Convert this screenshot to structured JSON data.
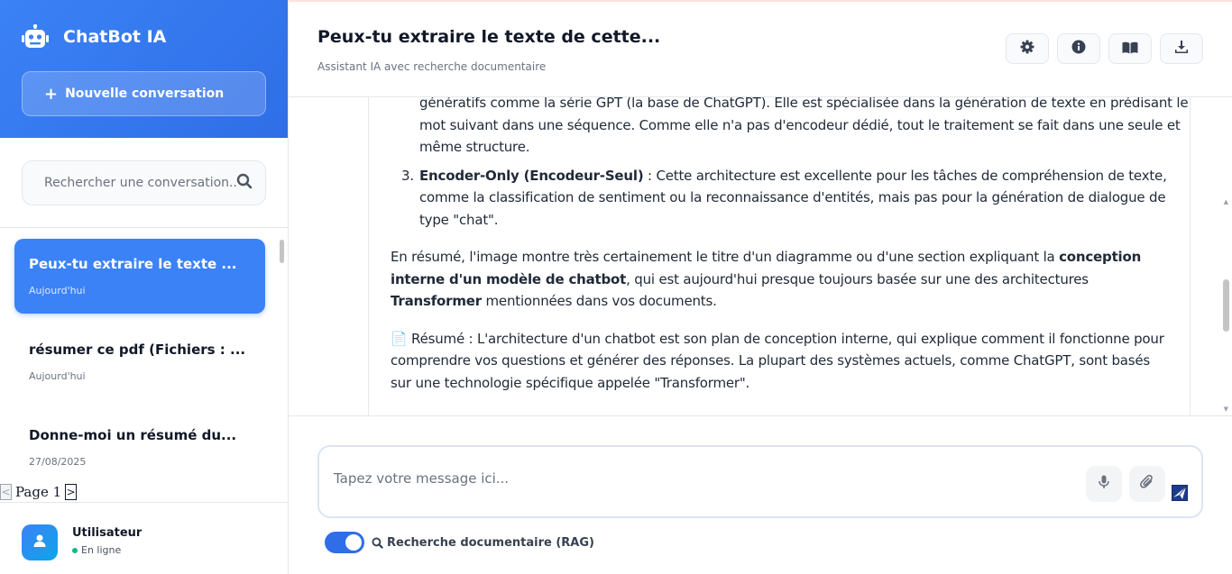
{
  "app": {
    "title": "ChatBot IA",
    "icons": {
      "brand": "robot-icon"
    },
    "colors": {
      "accent": "#3b82f6",
      "online": "#10b981"
    }
  },
  "sidebar": {
    "new_conversation_label": "Nouvelle conversation",
    "search_placeholder": "Rechercher une conversation...",
    "conversations": [
      {
        "title": "Peux-tu extraire le texte ...",
        "date": "Aujourd'hui",
        "active": true
      },
      {
        "title": "résumer ce pdf (Fichiers : ...",
        "date": "Aujourd'hui",
        "active": false
      },
      {
        "title": "Donne-moi un résumé du...",
        "date": "27/08/2025",
        "active": false
      }
    ],
    "pager": {
      "label": "Page 1",
      "prev": "<",
      "next": ">"
    },
    "user": {
      "name": "Utilisateur",
      "status": "En ligne"
    }
  },
  "header": {
    "title": "Peux-tu extraire le texte de cette...",
    "subtitle": "Assistant IA avec recherche documentaire",
    "actions": [
      "gear-icon",
      "info-icon",
      "book-icon",
      "download-icon"
    ]
  },
  "message": {
    "item2_cont_line1": "génératifs comme la série GPT (la base de ChatGPT). Elle est spécialisée dans la génération de texte en prédisant le",
    "item2_cont_line2": "mot suivant dans une séquence. Comme elle n'a pas d'encodeur dédié, tout le traitement se fait dans une seule et",
    "item2_cont_line3": "même structure.",
    "item3_number": "3.",
    "item3_bold": "Encoder-Only (Encodeur-Seul)",
    "item3_text": " : Cette architecture est excellente pour les tâches de compréhension de texte, comme la classification de sentiment ou la reconnaissance d'entités, mais pas pour la génération de dialogue de type \"chat\".",
    "summary_p1": "En résumé, l'image montre très certainement le titre d'un diagramme ou d'une section expliquant la ",
    "summary_b1": "conception interne d'un modèle de chatbot",
    "summary_p2": ", qui est aujourd'hui presque toujours basée sur une des architectures ",
    "summary_b2": "Transformer",
    "summary_p3": " mentionnées dans vos documents.",
    "resume_icon": "📄",
    "resume_text": " Résumé : L'architecture d'un chatbot est son plan de conception interne, qui explique comment il fonctionne pour comprendre vos questions et générer des réponses. La plupart des systèmes actuels, comme ChatGPT, sont basés sur une technologie spécifique appelée \"Transformer\"."
  },
  "composer": {
    "placeholder": "Tapez votre message ici...",
    "rag_label": "Recherche documentaire (RAG)",
    "rag_enabled": true
  }
}
